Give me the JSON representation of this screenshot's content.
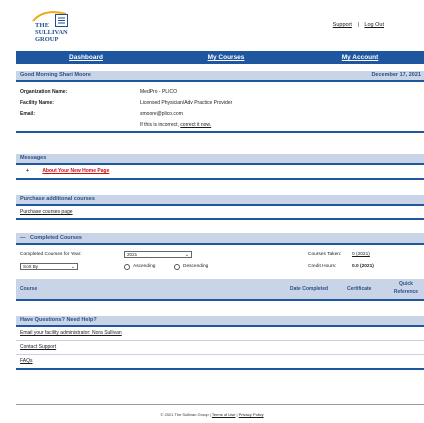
{
  "logo": {
    "line1": "THE",
    "line2": "SULLIVAN",
    "line3": "GROUP"
  },
  "toplinks": {
    "support": "Support",
    "separator": "|",
    "logout": "Log Out"
  },
  "nav": {
    "dashboard": "Dashboard",
    "courses": "My Courses",
    "account": "My Account"
  },
  "greeting": {
    "title": "Good Morning Shari Moore",
    "date": "December 17, 2021",
    "org_label": "Organization Name:",
    "org_value": "MedPro - PLICO",
    "facility_label": "Facility Name:",
    "facility_value": "Licensed Physician/Adv Practice Provider",
    "email_label": "Email:",
    "email_value": "smoore@plico.com",
    "incorrect_text": "If this is incorrect, ",
    "incorrect_link": "correct it now."
  },
  "messages": {
    "title": "Messages",
    "bullet": "+",
    "link": "About Your New Home Page"
  },
  "purchase": {
    "title": "Purchase additional courses",
    "link": "Purchase courses page"
  },
  "completed": {
    "title": "Completed Courses",
    "collapse_icon": "—",
    "year_label": "Completed Courses for Year:",
    "year_value": "2021",
    "sort_value": "Sort By",
    "ascending": "Ascending",
    "descending": "Descending",
    "taken_label": "Courses Taken:",
    "taken_value": "0 (2021)",
    "hours_label": "Credit Hours:",
    "hours_value": "0.0 (2021)",
    "col_course": "Course",
    "col_date": "Date Completed",
    "col_cert": "Certificate",
    "col_quick_1": "Quick",
    "col_quick_2": "Reference"
  },
  "questions": {
    "title": "Have Questions? Need Help?",
    "link1": "Email your facility administrator: Nora Sullivan",
    "link2": "Contact Support",
    "link3": "FAQs"
  },
  "footer": {
    "copyright": "© 2021 The Sullivan Group | ",
    "terms": "Terms of Use",
    "sep": " | ",
    "privacy": "Privacy Policy"
  },
  "colors": {
    "nav_blue": "#1e56a0",
    "header_gray_blue": "#c9d5e6",
    "message_red": "#cc1111"
  }
}
